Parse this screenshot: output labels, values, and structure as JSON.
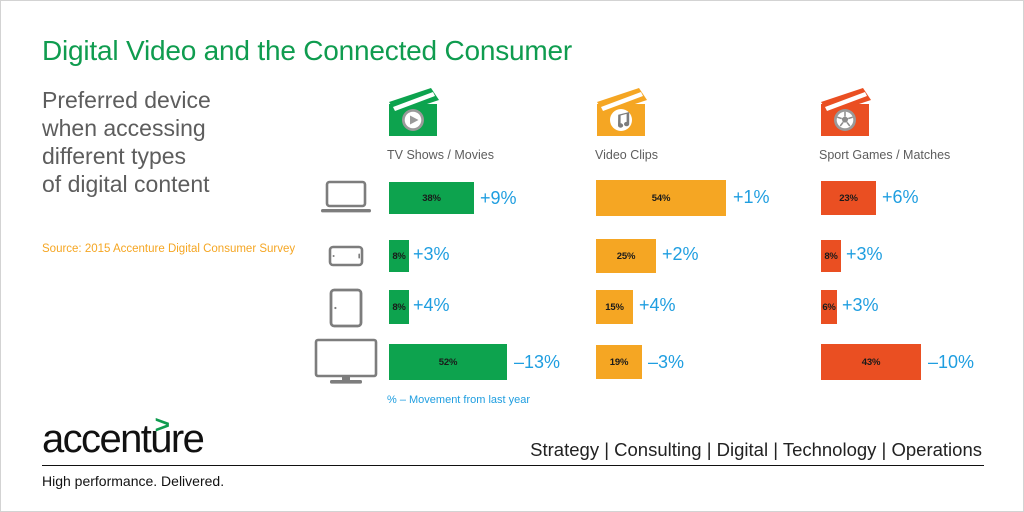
{
  "header": {
    "title": "Digital Video and the Connected Consumer",
    "subtitle_lines": [
      "Preferred device",
      "when accessing",
      "different types",
      "of digital content"
    ],
    "source": "Source: 2015 Accenture Digital Consumer Survey"
  },
  "footnote": "% – Movement from last year",
  "footer": {
    "logo": "accenture",
    "logo_arrow": ">",
    "tagline": "High performance. Delivered.",
    "services": "Strategy | Consulting | Digital | Technology | Operations"
  },
  "colors": {
    "green": "#0da34e",
    "orange": "#f5a623",
    "red": "#ea4f22",
    "blue": "#1f9ee0",
    "gray": "#5d5d5d",
    "title_green": "#0f9c4f"
  },
  "devices": [
    {
      "name": "laptop",
      "icon": "laptop-icon"
    },
    {
      "name": "smartphone",
      "icon": "smartphone-icon"
    },
    {
      "name": "tablet",
      "icon": "tablet-icon"
    },
    {
      "name": "television",
      "icon": "television-icon"
    }
  ],
  "columns": [
    {
      "label": "TV Shows / Movies",
      "icon": "clapperboard-play-icon",
      "color": "#0da34e"
    },
    {
      "label": "Video Clips",
      "icon": "clapperboard-music-icon",
      "color": "#f5a623"
    },
    {
      "label": "Sport Games / Matches",
      "icon": "clapperboard-sports-icon",
      "color": "#ea4f22"
    }
  ],
  "chart_data": {
    "type": "bar",
    "title": "Preferred device when accessing different types of digital content",
    "xlabel": "",
    "ylabel": "",
    "categories": [
      "TV Shows / Movies",
      "Video Clips",
      "Sport Games / Matches"
    ],
    "rows": [
      "Laptop",
      "Smartphone",
      "Tablet",
      "Television"
    ],
    "unit": "%",
    "note": "Second value per cell is the movement from last year",
    "series": [
      {
        "name": "TV Shows / Movies",
        "color": "#0da34e",
        "values": [
          38,
          8,
          8,
          52
        ],
        "value_labels": [
          "38%",
          "8%",
          "8%",
          "52%"
        ],
        "deltas": [
          9,
          3,
          4,
          -13
        ],
        "delta_labels": [
          "+9%",
          "+3%",
          "+4%",
          "–13%"
        ]
      },
      {
        "name": "Video Clips",
        "color": "#f5a623",
        "values": [
          54,
          25,
          15,
          19
        ],
        "value_labels": [
          "54%",
          "25%",
          "15%",
          "19%"
        ],
        "deltas": [
          1,
          2,
          4,
          -3
        ],
        "delta_labels": [
          "+1%",
          "+2%",
          "+4%",
          "–3%"
        ]
      },
      {
        "name": "Sport Games / Matches",
        "color": "#ea4f22",
        "values": [
          23,
          8,
          6,
          43
        ],
        "value_labels": [
          "23%",
          "8%",
          "6%",
          "43%"
        ],
        "deltas": [
          6,
          3,
          3,
          -10
        ],
        "delta_labels": [
          "+6%",
          "+3%",
          "+3%",
          "–10%"
        ]
      }
    ]
  }
}
